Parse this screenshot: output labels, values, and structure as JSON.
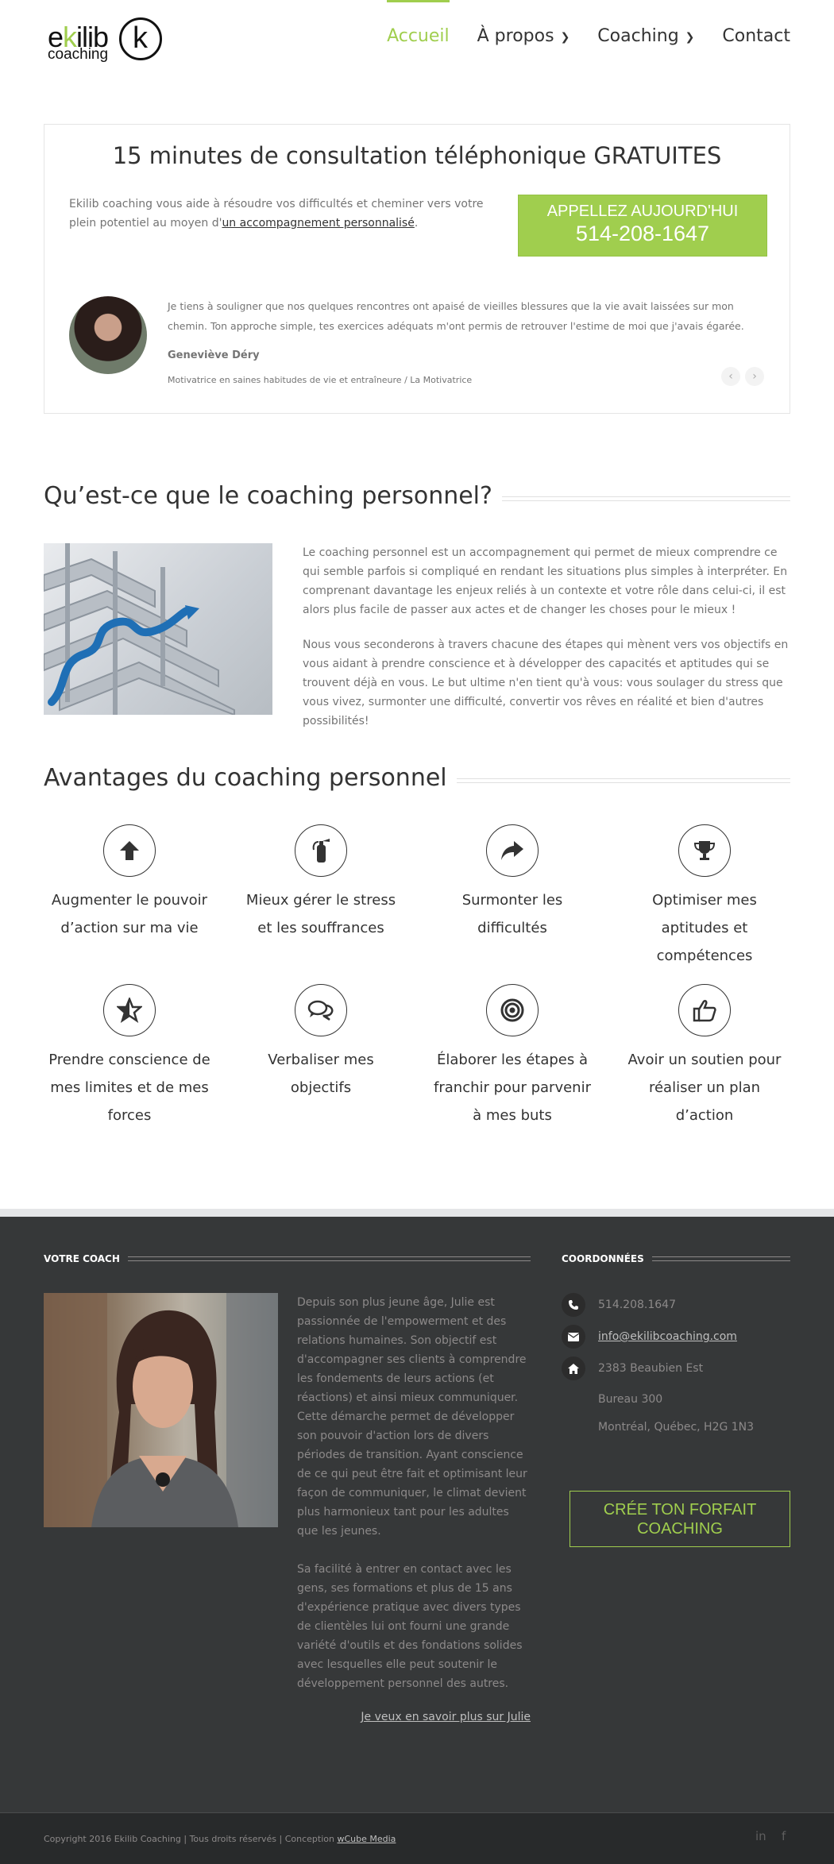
{
  "header": {
    "logo": {
      "word_prefix": "e",
      "word_highlight": "k",
      "word_suffix": "ilib",
      "subword": "coaching",
      "mark": "k"
    },
    "nav": [
      {
        "label": "Accueil"
      },
      {
        "label": "À propos"
      },
      {
        "label": "Coaching"
      },
      {
        "label": "Contact"
      }
    ]
  },
  "consult": {
    "title": "15 minutes de consultation téléphonique GRATUITES",
    "lead_before": "Ekilib coaching vous aide à résoudre vos difficultés et cheminer vers votre plein potentiel au moyen d'",
    "lead_link": "un accompagnement personnalisé",
    "lead_after": ".",
    "cta_line1": "APPELLEZ AUJOURD'HUI",
    "cta_line2": "514-208-1647",
    "testimonial": {
      "text": "Je tiens à souligner que nos quelques rencontres ont apaisé de vieilles blessures que la vie avait laissées sur mon chemin. Ton approche simple, tes exercices adéquats m'ont permis de retrouver l'estime de moi que j'avais égarée.",
      "name": "Geneviève Déry",
      "role": "Motivatrice en saines habitudes de vie et entraîneure / La Motivatrice",
      "prev": "‹",
      "next": "›"
    }
  },
  "coaching_section": {
    "title": "Qu’est-ce que le coaching personnel?",
    "p1": "Le coaching personnel est un accompagnement qui permet de mieux comprendre ce qui semble parfois si compliqué en rendant les situations plus simples à interpréter. En comprenant davantage les enjeux reliés à un contexte et votre rôle dans celui-ci, il est alors plus facile de passer aux actes et de changer les choses pour le mieux !",
    "p2": "Nous vous seconderons à travers chacune des étapes qui mènent vers vos objectifs en vous aidant à prendre conscience et à développer des capacités et aptitudes qui se trouvent déjà en vous. Le but ultime n'en tient qu'à vous: vous soulager du stress que vous vivez, surmonter une difficulté, convertir vos rêves en réalité et bien d'autres possibilités!"
  },
  "benefits": {
    "title": "Avantages du coaching personnel",
    "items": [
      {
        "icon": "arrow-up-icon",
        "label": "Augmenter le pouvoir d’action sur ma vie"
      },
      {
        "icon": "fire-extinguisher-icon",
        "label": "Mieux gérer le stress et les souffrances"
      },
      {
        "icon": "share-arrow-icon",
        "label": "Surmonter les difficultés"
      },
      {
        "icon": "trophy-icon",
        "label": "Optimiser mes aptitudes et compétences"
      },
      {
        "icon": "star-icon",
        "label": "Prendre conscience de mes limites et de mes forces"
      },
      {
        "icon": "chat-bubbles-icon",
        "label": "Verbaliser mes objectifs"
      },
      {
        "icon": "target-icon",
        "label": "Élaborer les étapes à franchir pour parvenir à mes buts"
      },
      {
        "icon": "thumbs-up-icon",
        "label": "Avoir un soutien pour réaliser un plan d’action"
      }
    ]
  },
  "footer": {
    "coach_heading": "VOTRE COACH",
    "coach_p1": "Depuis son plus jeune âge, Julie est passionnée de l'empowerment et des relations humaines. Son objectif est d'accompagner ses clients à comprendre les fondements de leurs actions (et réactions) et ainsi mieux communiquer. Cette démarche permet de développer son pouvoir d'action lors de divers périodes de transition. Ayant conscience de ce qui peut être fait et optimisant leur façon de communiquer, le climat devient plus harmonieux tant pour les adultes que les jeunes.",
    "coach_p2": "Sa facilité à entrer en contact avec les gens, ses formations et plus de 15 ans d'expérience pratique avec divers types de clientèles lui ont fourni une grande variété d'outils et des fondations solides avec lesquelles elle peut soutenir le développement personnel des autres.",
    "coach_link": "Je veux en savoir plus sur Julie",
    "contact_heading": "COORDONNÉES",
    "phone": "514.208.1647",
    "email": "info@ekilibcoaching.com",
    "address1": "2383 Beaubien Est",
    "address2": "Bureau 300",
    "address3": "Montréal, Québec, H2G 1N3",
    "forfait_button": "CRÉE TON FORFAIT COACHING"
  },
  "copyright": {
    "text": "Copyright 2016 Ekilib Coaching | Tous droits réservés | Conception ",
    "link": "wCube Media",
    "social": [
      "in",
      "f"
    ]
  },
  "colors": {
    "accent": "#a0ce4e",
    "footer_bg": "#363839",
    "text": "#747474",
    "heading": "#333333"
  }
}
